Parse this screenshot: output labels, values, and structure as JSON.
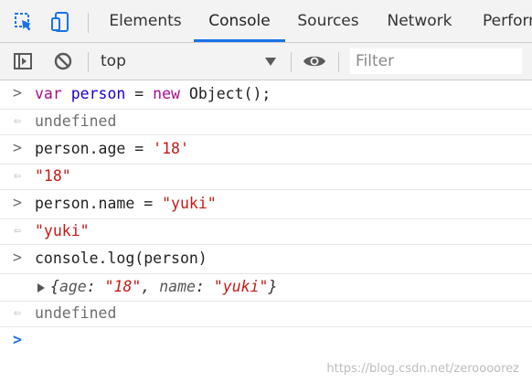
{
  "tabs": [
    {
      "label": "Elements"
    },
    {
      "label": "Console",
      "active": true
    },
    {
      "label": "Sources"
    },
    {
      "label": "Network"
    },
    {
      "label": "Perforn"
    }
  ],
  "toolbar": {
    "context": "top",
    "filter_placeholder": "Filter"
  },
  "console": {
    "entries": [
      {
        "type": "input",
        "parts": [
          "var",
          " ",
          "person",
          " = ",
          "new",
          " Object();"
        ]
      },
      {
        "type": "result",
        "text": "undefined"
      },
      {
        "type": "input",
        "parts": [
          "person.age = ",
          "'18'"
        ]
      },
      {
        "type": "result",
        "text": "\"18\""
      },
      {
        "type": "input",
        "parts": [
          "person.name = ",
          "\"yuki\""
        ]
      },
      {
        "type": "result",
        "text": "\"yuki\""
      },
      {
        "type": "input",
        "parts": [
          "console.log(person)"
        ]
      },
      {
        "type": "log",
        "parts": [
          "{",
          "age",
          ": ",
          "\"18\"",
          ", ",
          "name",
          ": ",
          "\"yuki\"",
          "}"
        ]
      },
      {
        "type": "result",
        "text": "undefined"
      }
    ]
  },
  "watermark": "https://blog.csdn.net/zeroooorez",
  "colors": {
    "accent": "#1a73e8",
    "keyword": "#aa0d91",
    "string": "#c41a16",
    "variable": "#1c00cf"
  }
}
